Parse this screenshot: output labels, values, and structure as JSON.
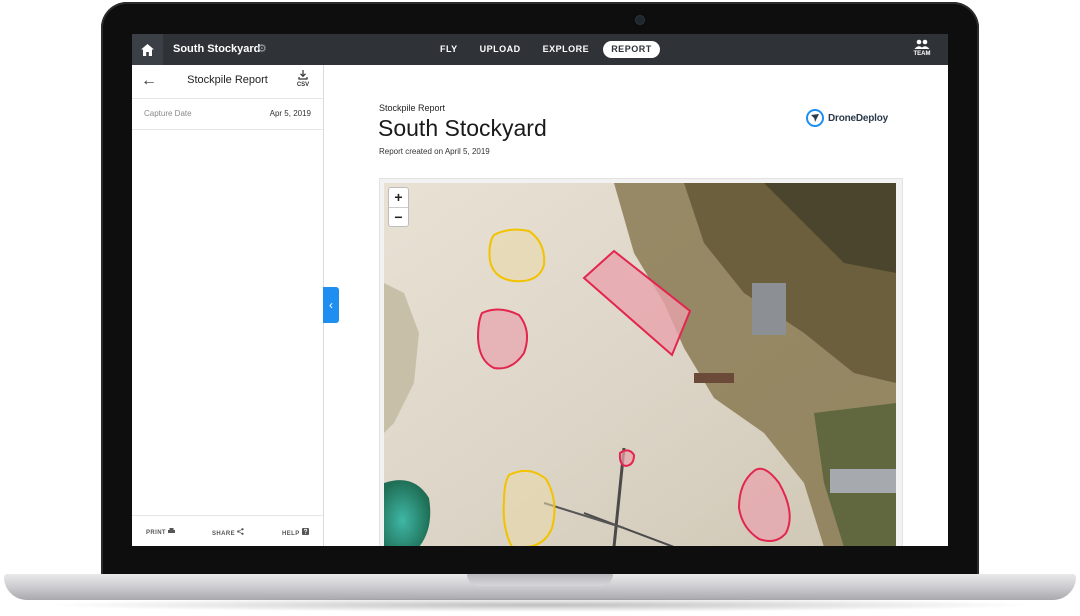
{
  "topbar": {
    "project_title": "South Stockyard",
    "nav": [
      {
        "label": "FLY",
        "active": false
      },
      {
        "label": "UPLOAD",
        "active": false
      },
      {
        "label": "EXPLORE",
        "active": false
      },
      {
        "label": "REPORT",
        "active": true
      }
    ],
    "team_label": "TEAM",
    "icons": {
      "home": "home-icon",
      "settings": "gear-icon",
      "team": "team-icon"
    }
  },
  "sidebar": {
    "title": "Stockpile Report",
    "csv_label": "CSV",
    "capture": {
      "label": "Capture Date",
      "value": "Apr 5, 2019"
    },
    "footer": {
      "print": "PRINT",
      "share": "SHARE",
      "help": "HELP"
    }
  },
  "report": {
    "kicker": "Stockpile Report",
    "title": "South Stockyard",
    "created": "Report created on April 5, 2019",
    "brand": "DroneDeploy"
  },
  "map": {
    "zoom_in": "+",
    "zoom_out": "−",
    "colors": {
      "red_outline": "#e2264d",
      "yellow_outline": "#f2c200"
    }
  },
  "colors": {
    "topbar": "#2f3338",
    "accent": "#1f8ef1"
  }
}
